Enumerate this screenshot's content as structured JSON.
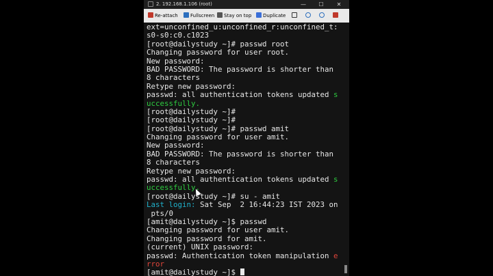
{
  "window": {
    "title": "2. 192.168.1.106 (root)",
    "controls": {
      "minimize": "—",
      "maximize": "☐",
      "close": "✕"
    }
  },
  "toolbar": {
    "reattach": "Re-attach",
    "fullscreen": "Fullscreen",
    "stay_on_top": "Stay on top",
    "duplicate": "Duplicate"
  },
  "terminal": {
    "lines": [
      [
        "ext=unconfined_u:unconfined_r:unconfined_t:"
      ],
      [
        "s0-s0:c0.c1023"
      ],
      [
        "[root@dailystudy ~]# passwd root"
      ],
      [
        "Changing password for user root."
      ],
      [
        "New password:"
      ],
      [
        "BAD PASSWORD: The password is shorter than"
      ],
      [
        "8 characters"
      ],
      [
        "Retype new password:"
      ],
      [
        "passwd: all authentication tokens updated ",
        "s"
      ],
      [
        "uccessfully."
      ],
      [
        "[root@dailystudy ~]#"
      ],
      [
        "[root@dailystudy ~]#"
      ],
      [
        "[root@dailystudy ~]# passwd amit"
      ],
      [
        "Changing password for user amit."
      ],
      [
        "New password:"
      ],
      [
        "BAD PASSWORD: The password is shorter than"
      ],
      [
        "8 characters"
      ],
      [
        "Retype new password:"
      ],
      [
        "passwd: all authentication tokens updated ",
        "s"
      ],
      [
        "uccessfully."
      ],
      [
        "[root@dailystudy ~]# su - amit"
      ],
      [
        "Last login:",
        " Sat Sep  2 16:44:23 IST 2023 on"
      ],
      [
        " pts/0"
      ],
      [
        "[amit@dailystudy ~]$ passwd"
      ],
      [
        "Changing password for user amit."
      ],
      [
        "Changing password for amit."
      ],
      [
        "(current) UNIX password:"
      ],
      [
        "passwd: Authentication token manipulation ",
        "e"
      ],
      [
        "rror"
      ],
      [
        "[amit@dailystudy ~]$ "
      ]
    ]
  },
  "colors": {
    "success": "#2ecc40",
    "info": "#20b2cc",
    "error": "#e0453a"
  }
}
